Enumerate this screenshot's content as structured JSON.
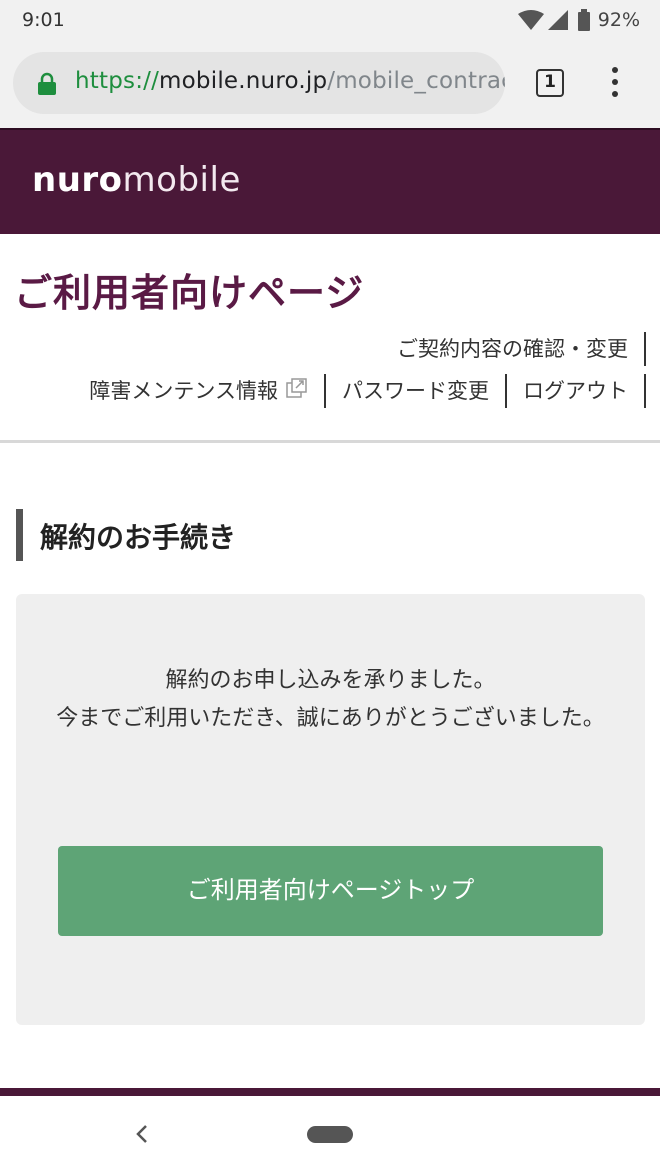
{
  "status": {
    "time": "9:01",
    "battery": "92%",
    "icons": [
      "wifi-icon",
      "signal-icon",
      "battery-icon"
    ]
  },
  "browser": {
    "url_scheme": "https://",
    "url_host": "mobile.nuro.jp",
    "url_path": "/mobile_contract/u",
    "tab_count": "1"
  },
  "header": {
    "logo_bold": "nuro",
    "logo_light": "mobile",
    "brand_color": "#4a1838"
  },
  "page": {
    "title": "ご利用者向けページ",
    "nav": {
      "contract": "ご契約内容の確認・変更",
      "maintenance": "障害メンテンス情報",
      "password": "パスワード変更",
      "logout": "ログアウト"
    }
  },
  "section": {
    "title": "解約のお手続き",
    "message": "解約のお申し込みを承りました。今までご利用いただき、誠にありがとうございました。",
    "message_line1": "解約のお申し込みを承りました。",
    "message_line2": "今までご利用いただき、誠にありがとうございました。",
    "button_label": "ご利用者向けページトップ",
    "button_color": "#5ea476"
  }
}
